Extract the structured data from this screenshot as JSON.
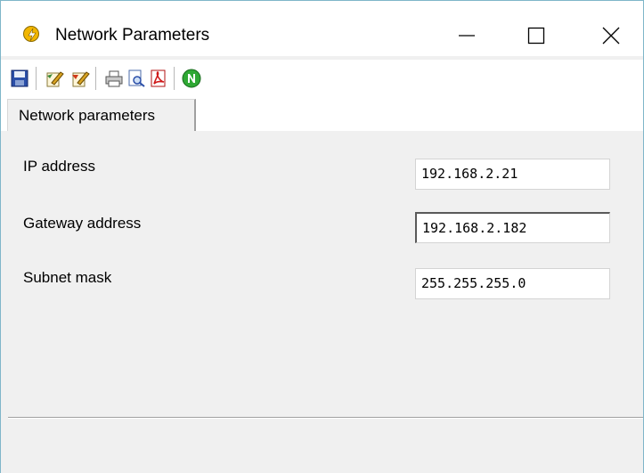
{
  "window": {
    "title": "Network Parameters",
    "icon": "lightning-icon"
  },
  "title_buttons": {
    "minimize": "minimize-icon",
    "maximize": "maximize-icon",
    "close": "close-icon"
  },
  "toolbar": {
    "items": [
      {
        "name": "save",
        "icon": "floppy-disk-icon"
      },
      {
        "name": "read-from-device",
        "icon": "pencil-paper-icon"
      },
      {
        "name": "write-to-device",
        "icon": "pencil-paper-red-icon"
      },
      {
        "name": "print",
        "icon": "printer-icon"
      },
      {
        "name": "print-preview",
        "icon": "print-preview-icon"
      },
      {
        "name": "export-pdf",
        "icon": "pdf-icon"
      },
      {
        "name": "network",
        "icon": "green-n-icon"
      }
    ]
  },
  "tabs": [
    {
      "label": "Network parameters"
    }
  ],
  "fields": {
    "ip": {
      "label": "IP address",
      "value": "192.168.2.21"
    },
    "gateway": {
      "label": "Gateway address",
      "value": "192.168.2.182"
    },
    "subnet": {
      "label": "Subnet mask",
      "value": "255.255.255.0"
    }
  },
  "colors": {
    "window_border": "#7fb6c9",
    "panel_bg": "#f0f0f0",
    "app_icon": "#f2b600",
    "n_icon": "#2fa834"
  }
}
